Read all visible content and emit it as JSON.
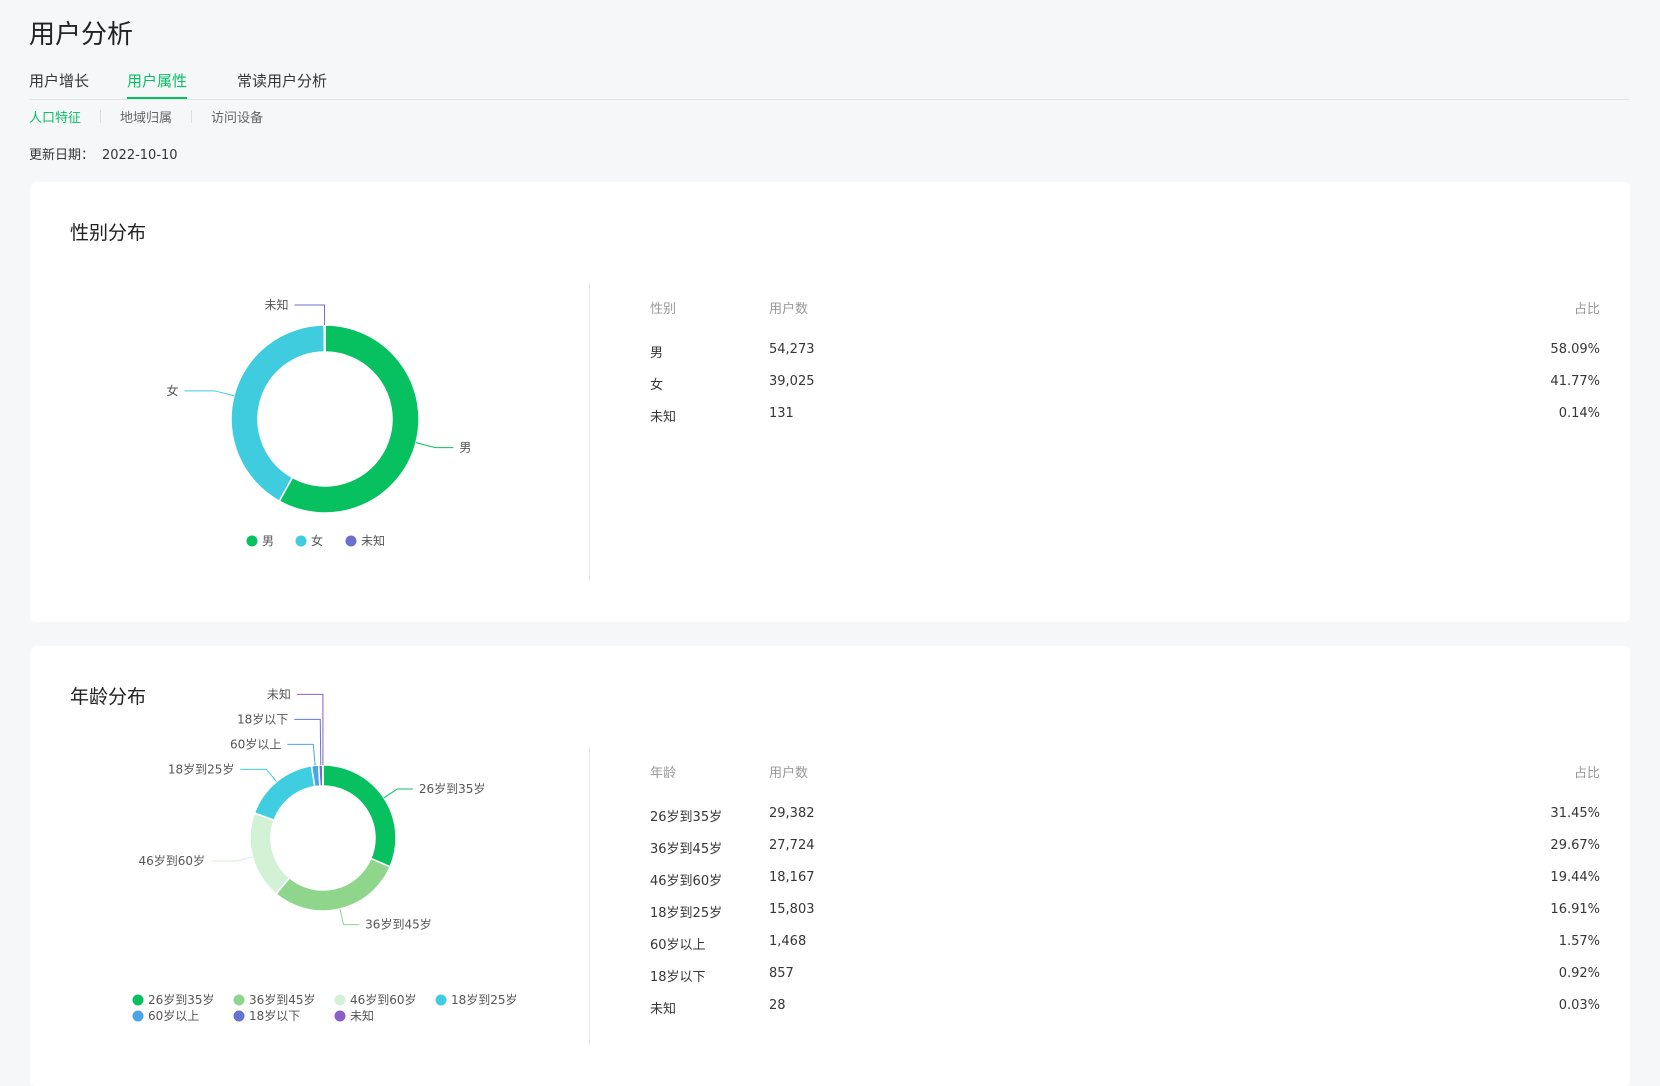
{
  "page_title": "用户分析",
  "tabs": [
    {
      "label": "用户增长",
      "active": false
    },
    {
      "label": "用户属性",
      "active": true
    },
    {
      "label": "常读用户分析",
      "active": false
    }
  ],
  "subtabs": [
    {
      "label": "人口特征",
      "active": true
    },
    {
      "label": "地域归属",
      "active": false
    },
    {
      "label": "访问设备",
      "active": false
    }
  ],
  "update_date": {
    "label": "更新日期：",
    "value": "2022-10-10"
  },
  "colors": {
    "accent": "#07c160",
    "male": "#07c160",
    "female": "#40ccdf",
    "unknown_gender": "#6c6fcf",
    "age_26_35": "#07c160",
    "age_36_45": "#8fd68c",
    "age_46_60": "#d3f1d5",
    "age_18_25": "#3fcde0",
    "age_60_plus": "#4aa5e8",
    "age_under_18": "#6674d1",
    "age_unknown": "#8b5fc7"
  },
  "gender": {
    "title": "性别分布",
    "headers": {
      "category": "性别",
      "count": "用户数",
      "ratio": "占比"
    },
    "rows": [
      {
        "category": "男",
        "count": "54,273",
        "ratio": "58.09%"
      },
      {
        "category": "女",
        "count": "39,025",
        "ratio": "41.77%"
      },
      {
        "category": "未知",
        "count": "131",
        "ratio": "0.14%"
      }
    ]
  },
  "age": {
    "title": "年龄分布",
    "headers": {
      "category": "年龄",
      "count": "用户数",
      "ratio": "占比"
    },
    "rows": [
      {
        "category": "26岁到35岁",
        "count": "29,382",
        "ratio": "31.45%"
      },
      {
        "category": "36岁到45岁",
        "count": "27,724",
        "ratio": "29.67%"
      },
      {
        "category": "46岁到60岁",
        "count": "18,167",
        "ratio": "19.44%"
      },
      {
        "category": "18岁到25岁",
        "count": "15,803",
        "ratio": "16.91%"
      },
      {
        "category": "60岁以上",
        "count": "1,468",
        "ratio": "1.57%"
      },
      {
        "category": "18岁以下",
        "count": "857",
        "ratio": "0.92%"
      },
      {
        "category": "未知",
        "count": "28",
        "ratio": "0.03%"
      }
    ]
  },
  "chart_data": [
    {
      "type": "pie",
      "donut": true,
      "categories": [
        "男",
        "女",
        "未知"
      ],
      "values": [
        54273,
        39025,
        131
      ],
      "percentages": [
        58.09,
        41.77,
        0.14
      ],
      "colors": [
        "#07c160",
        "#40ccdf",
        "#6c6fcf"
      ],
      "legend": "bottom",
      "title": "性别分布"
    },
    {
      "type": "pie",
      "donut": true,
      "categories": [
        "26岁到35岁",
        "36岁到45岁",
        "46岁到60岁",
        "18岁到25岁",
        "60岁以上",
        "18岁以下",
        "未知"
      ],
      "values": [
        29382,
        27724,
        18167,
        15803,
        1468,
        857,
        28
      ],
      "percentages": [
        31.45,
        29.67,
        19.44,
        16.91,
        1.57,
        0.92,
        0.03
      ],
      "colors": [
        "#07c160",
        "#8fd68c",
        "#d3f1d5",
        "#3fcde0",
        "#4aa5e8",
        "#6674d1",
        "#8b5fc7"
      ],
      "legend": "bottom",
      "title": "年龄分布"
    }
  ]
}
